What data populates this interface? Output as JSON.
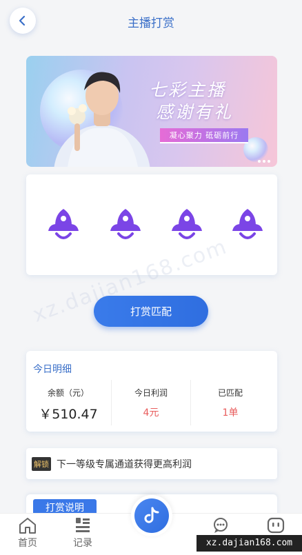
{
  "header": {
    "title": "主播打赏"
  },
  "banner": {
    "title_line1": "七彩主播",
    "title_line2": "感谢有礼",
    "slogan": "凝心聚力 砥砺前行"
  },
  "reward_button": {
    "label": "打赏匹配"
  },
  "today": {
    "title": "今日明细",
    "balance": {
      "label": "余额（元）",
      "value": "￥510.47"
    },
    "profit": {
      "label": "今日利润",
      "value": "4元"
    },
    "matched": {
      "label": "已匹配",
      "value": "1单"
    }
  },
  "notice": {
    "badge": "解锁",
    "text": "下一等级专属通道获得更高利润"
  },
  "explain": {
    "tag": "打赏说明"
  },
  "tabbar": {
    "items": [
      {
        "label": "首页"
      },
      {
        "label": "记录"
      },
      {
        "label": "客服"
      },
      {
        "label": "我的"
      }
    ]
  },
  "watermark": "xz.dajian168.com",
  "site_badge": "xz.dajian168.com",
  "colors": {
    "accent": "#3a6fc8",
    "button": "#2f6ee0",
    "rocket": "#7b45e6",
    "red_value": "#e85c5c"
  }
}
